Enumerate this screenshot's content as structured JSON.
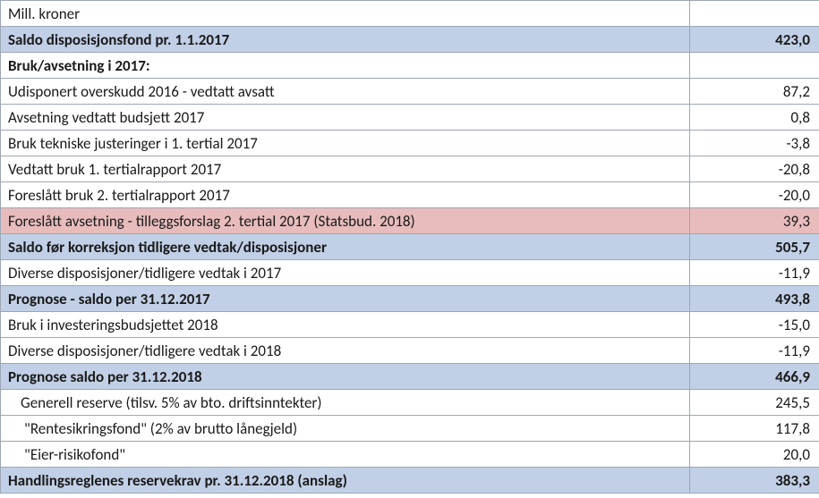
{
  "chart_data": {
    "type": "table",
    "title": "Mill. kroner",
    "rows": [
      {
        "label": "Mill. kroner",
        "value": "",
        "style": "header"
      },
      {
        "label": "Saldo disposisjonsfond pr. 1.1.2017",
        "value": "423,0",
        "style": "blue-bold"
      },
      {
        "label": "Bruk/avsetning i 2017:",
        "value": "",
        "style": "bold"
      },
      {
        "label": "Udisponert overskudd 2016 - vedtatt avsatt",
        "value": "87,2",
        "style": ""
      },
      {
        "label": "Avsetning vedtatt budsjett 2017",
        "value": "0,8",
        "style": ""
      },
      {
        "label": "Bruk tekniske justeringer i 1. tertial 2017",
        "value": "-3,8",
        "style": ""
      },
      {
        "label": "Vedtatt  bruk 1. tertialrapport 2017",
        "value": "-20,8",
        "style": ""
      },
      {
        "label": "Foreslått bruk 2. tertialrapport 2017",
        "value": "-20,0",
        "style": ""
      },
      {
        "label": "Foreslått avsetning - tilleggsforslag 2. tertial 2017 (Statsbud. 2018)",
        "value": "39,3",
        "style": "red"
      },
      {
        "label": "Saldo før korreksjon tidligere vedtak/disposisjoner",
        "value": "505,7",
        "style": "blue-bold"
      },
      {
        "label": "Diverse disposisjoner/tidligere vedtak i 2017",
        "value": "-11,9",
        "style": ""
      },
      {
        "label": "Prognose - saldo per 31.12.2017",
        "value": "493,8",
        "style": "blue-bold"
      },
      {
        "label": "Bruk i investeringsbudsjettet 2018",
        "value": "-15,0",
        "style": ""
      },
      {
        "label": "Diverse disposisjoner/tidligere vedtak i 2018",
        "value": "-11,9",
        "style": ""
      },
      {
        "label": "Prognose saldo per 31.12.2018",
        "value": "466,9",
        "style": "blue-bold"
      },
      {
        "label": "Generell reserve (tilsv. 5% av bto. driftsinntekter)",
        "value": "245,5",
        "style": "indent1"
      },
      {
        "label": "\"Rentesikringsfond\" (2% av brutto lånegjeld)",
        "value": "117,8",
        "style": "indent2"
      },
      {
        "label": "\"Eier-risikofond\"",
        "value": "20,0",
        "style": "indent2"
      },
      {
        "label": "Handlingsreglenes reservekrav pr. 31.12.2018 (anslag)",
        "value": "383,3",
        "style": "blue-bold"
      }
    ]
  }
}
